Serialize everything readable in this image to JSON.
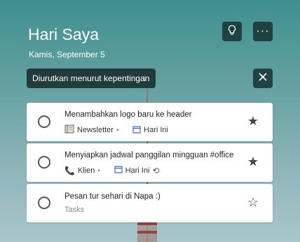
{
  "header": {
    "title": "Hari Saya",
    "subtitle": "Kamis, September 5"
  },
  "toolbar": {
    "suggestions_icon": "lightbulb-icon",
    "more_icon": "more-icon"
  },
  "sort": {
    "label": "Diurutkan menurut kepentingan",
    "close_icon": "close-icon"
  },
  "tasks": [
    {
      "title": "Menambahkan logo baru ke header",
      "list_icon": "notebook-icon",
      "list": "Newsletter",
      "due_icon": "calendar-icon",
      "due": "Hari Ini",
      "important": true
    },
    {
      "title": "Menyiapkan jadwal panggilan mingguan #office",
      "list_icon": "phone-icon",
      "list": "Klien",
      "due_icon": "calendar-icon",
      "due": "Hari Ini",
      "repeat_icon": "repeat-icon",
      "important": true
    },
    {
      "title": "Pesan tur sehari di Napa :)",
      "list": "Tasks",
      "important": false
    }
  ],
  "colors": {
    "accent": "#3a66c8",
    "background_top": "#3f8f8f",
    "background_bottom": "#a9c5cc",
    "dark_button": "#163234"
  }
}
